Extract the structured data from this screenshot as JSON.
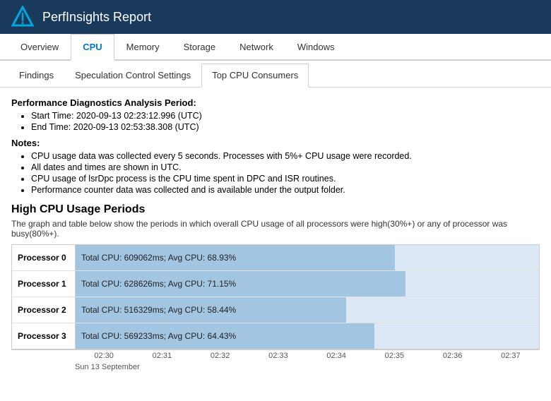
{
  "header": {
    "title": "PerfInsights Report"
  },
  "mainTabs": [
    {
      "label": "Overview",
      "active": false
    },
    {
      "label": "CPU",
      "active": true
    },
    {
      "label": "Memory",
      "active": false
    },
    {
      "label": "Storage",
      "active": false
    },
    {
      "label": "Network",
      "active": false
    },
    {
      "label": "Windows",
      "active": false
    }
  ],
  "subTabs": [
    {
      "label": "Findings",
      "active": false
    },
    {
      "label": "Speculation Control Settings",
      "active": false
    },
    {
      "label": "Top CPU Consumers",
      "active": true
    }
  ],
  "analysisSection": {
    "label": "Performance Diagnostics Analysis Period:",
    "bullets": [
      "Start Time: 2020-09-13 02:23:12.996 (UTC)",
      "End Time: 2020-09-13 02:53:38.308 (UTC)"
    ]
  },
  "notesSection": {
    "label": "Notes:",
    "bullets": [
      "CPU usage data was collected every 5 seconds. Processes with 5%+ CPU usage were recorded.",
      "All dates and times are shown in UTC.",
      "CPU usage of lsrDpc process is the CPU time spent in DPC and ISR routines.",
      "Performance counter data was collected and is available under the output folder."
    ]
  },
  "highCpuSection": {
    "title": "High CPU Usage Periods",
    "description": "The graph and table below show the periods in which overall CPU usage of all processors were high(30%+) or any of processor was busy(80%+).",
    "processors": [
      {
        "label": "Processor 0",
        "text": "Total CPU: 609062ms; Avg CPU: 68.93%",
        "pct": 68.93
      },
      {
        "label": "Processor 1",
        "text": "Total CPU: 628626ms; Avg CPU: 71.15%",
        "pct": 71.15
      },
      {
        "label": "Processor 2",
        "text": "Total CPU: 516329ms; Avg CPU: 58.44%",
        "pct": 58.44
      },
      {
        "label": "Processor 3",
        "text": "Total CPU: 569233ms; Avg CPU: 64.43%",
        "pct": 64.43
      }
    ],
    "xAxisLabels": [
      "02:30",
      "02:31",
      "02:32",
      "02:33",
      "02:34",
      "02:35",
      "02:36",
      "02:37"
    ],
    "xAxisSub": "Sun 13 September"
  }
}
